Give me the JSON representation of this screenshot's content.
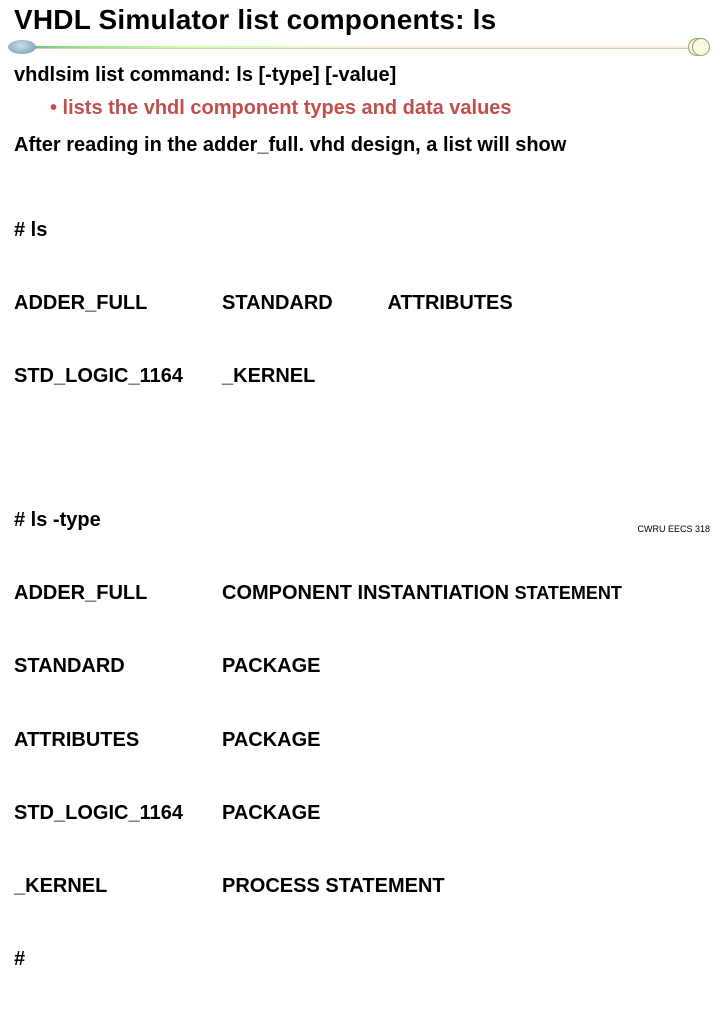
{
  "title": "VHDL Simulator list components: ls",
  "cmd": "vhdlsim list command: ls [-type] [-value]",
  "bullet": "• lists the vhdl component types and data values",
  "after": "After reading in the adder_full. vhd design, a list will show",
  "blk1": {
    "h": "# ls",
    "r0c1": "ADDER_FULL",
    "r0c2": "STANDARD          ATTRIBUTES",
    "r1c1": "STD_LOGIC_1164",
    "r1c2": "_KERNEL"
  },
  "blk2": {
    "h": "# ls -type",
    "r0c1": "ADDER_FULL",
    "r0c2a": "COMPONENT INSTANTIATION ",
    "r0c2b": "STATEMENT",
    "r1c1": "STANDARD",
    "r1c2": "PACKAGE",
    "r2c1": "ATTRIBUTES",
    "r2c2": "PACKAGE",
    "r3c1": "STD_LOGIC_1164",
    "r3c2": "PACKAGE",
    "r4c1": "_KERNEL",
    "r4c2": "PROCESS STATEMENT",
    "tail": "#"
  },
  "footer": "CWRU EECS 318"
}
